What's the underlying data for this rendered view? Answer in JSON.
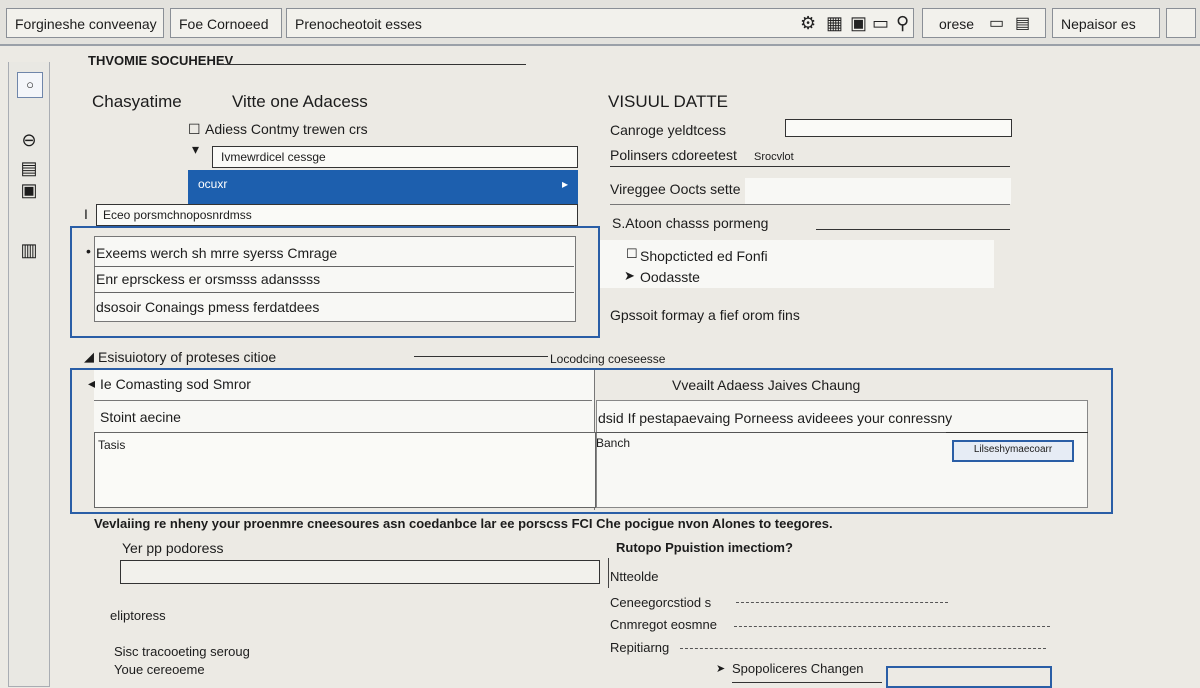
{
  "toolbar": {
    "tab1": "Forgineshe conveenay",
    "tab2": "Foe Cornoeed",
    "tab3": "Prenocheotoit esses",
    "tab4": "orese",
    "tab5": "Nepaisor es",
    "icons": [
      "gear-icon",
      "grid-icon",
      "frame-icon",
      "search-icon",
      "folder-icon",
      "card-icon"
    ]
  },
  "page_heading": "THVOMIE SOCUHEHEV",
  "left": {
    "section_title": "Chasyatime",
    "section_subtitle": "Vitte one Adacess",
    "row1": "Adiess Contmy trewen crs",
    "dropdown1": "Ivmewrdicel cessge",
    "blue_header": "ocuxr",
    "field2": "Eceo porsmchnoposnrdmss",
    "list": [
      "Exeems werch sh mrre syerss Cmrage",
      "Enr eprsckess er orsmsss adanssss",
      "dsosoir Conaings pmess ferdatdees"
    ]
  },
  "right": {
    "title": "VISUUL DATTE",
    "rows": [
      {
        "label": "Canroge yeldtcess",
        "value": ""
      },
      {
        "label": "Polinsers cdoreetest",
        "value": "Srocvlot"
      },
      {
        "label": "Vireggee Oocts sette",
        "value": ""
      },
      {
        "label": "S.Atoon chasss pormeng",
        "value": ""
      }
    ],
    "checks": [
      "Shopcticted ed Fonfi",
      "Oodasste"
    ],
    "footer": "Gpssoit formay a fief orom fins"
  },
  "middle": {
    "row_left": "Esisuiotory of proteses citioe",
    "row_right": "Locodcing coeseesse",
    "panel_title": "Vveailt Adaess Jaives Chaung",
    "field_a": "Ie Comasting sod Smror",
    "field_b": "Stoint aecine",
    "field_c": "Tasis",
    "field_d": "dsid If pestapaevaing Porneess avideees your conressny",
    "field_e": "Banch",
    "button": "Lilseshymaecoarr"
  },
  "bottom": {
    "notice": "Vevlaiing re nheny your proenmre cneesoures asn coedanbce lar ee porscss FCI Che pocigue nvon Alones to teegores.",
    "q1": "Yer pp podoress",
    "q2": "eliptoress",
    "q3": "Sisc tracooeting seroug",
    "q4": "Youe cereoeme",
    "r_title": "Rutopo Ppuistion imectiom?",
    "r1": "Ntteolde",
    "r2": "Ceneegorcstiod s",
    "r3": "Cnmregot eosmne",
    "r4": "Repitiarng",
    "r5": "Spopoliceres Changen"
  }
}
